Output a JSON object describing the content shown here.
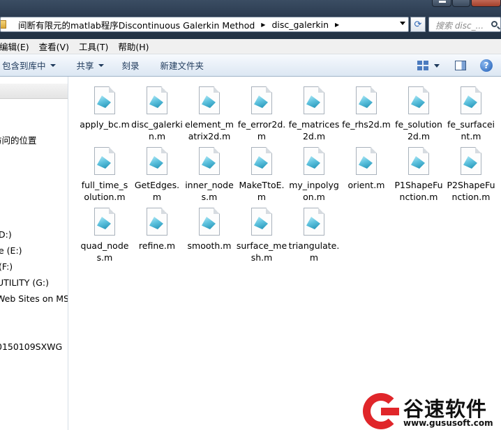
{
  "window": {
    "address_crumbs": [
      "间断有限元的matlab程序Discontinuous Galerkin Method",
      "disc_galerkin"
    ],
    "search_placeholder": "搜索 disc_..."
  },
  "menu": [
    "编辑(E)",
    "查看(V)",
    "工具(T)",
    "帮助(H)"
  ],
  "commands": {
    "include_library": "包含到库中",
    "share": "共享",
    "burn": "刻录",
    "new_folder": "新建文件夹"
  },
  "nav": {
    "items": [
      "访问的位置",
      "D:)",
      "e (E:)",
      " (F:)",
      "UTILITY (G:)",
      "Web Sites on MSN",
      "0150109SXWG"
    ]
  },
  "files": [
    "apply_bc.m",
    "disc_galerkin.m",
    "element_matrix2d.m",
    "fe_error2d.m",
    "fe_matrices2d.m",
    "fe_rhs2d.m",
    "fe_solution2d.m",
    "fe_surfaceint.m",
    "full_time_solution.m",
    "GetEdges.m",
    "inner_nodes.m",
    "MakeTtoE.m",
    "my_inpolygon.m",
    "orient.m",
    "P1ShapeFunction.m",
    "P2ShapeFunction.m",
    "quad_nodes.m",
    "refine.m",
    "smooth.m",
    "surface_mesh.m",
    "triangulate.m"
  ],
  "watermark": {
    "brand": "谷速软件",
    "url": "www.gususoft.com"
  },
  "colors": {
    "titlebar": "#2a3a4f",
    "command_text": "#1e395b",
    "watermark_red": "#e0262a"
  }
}
